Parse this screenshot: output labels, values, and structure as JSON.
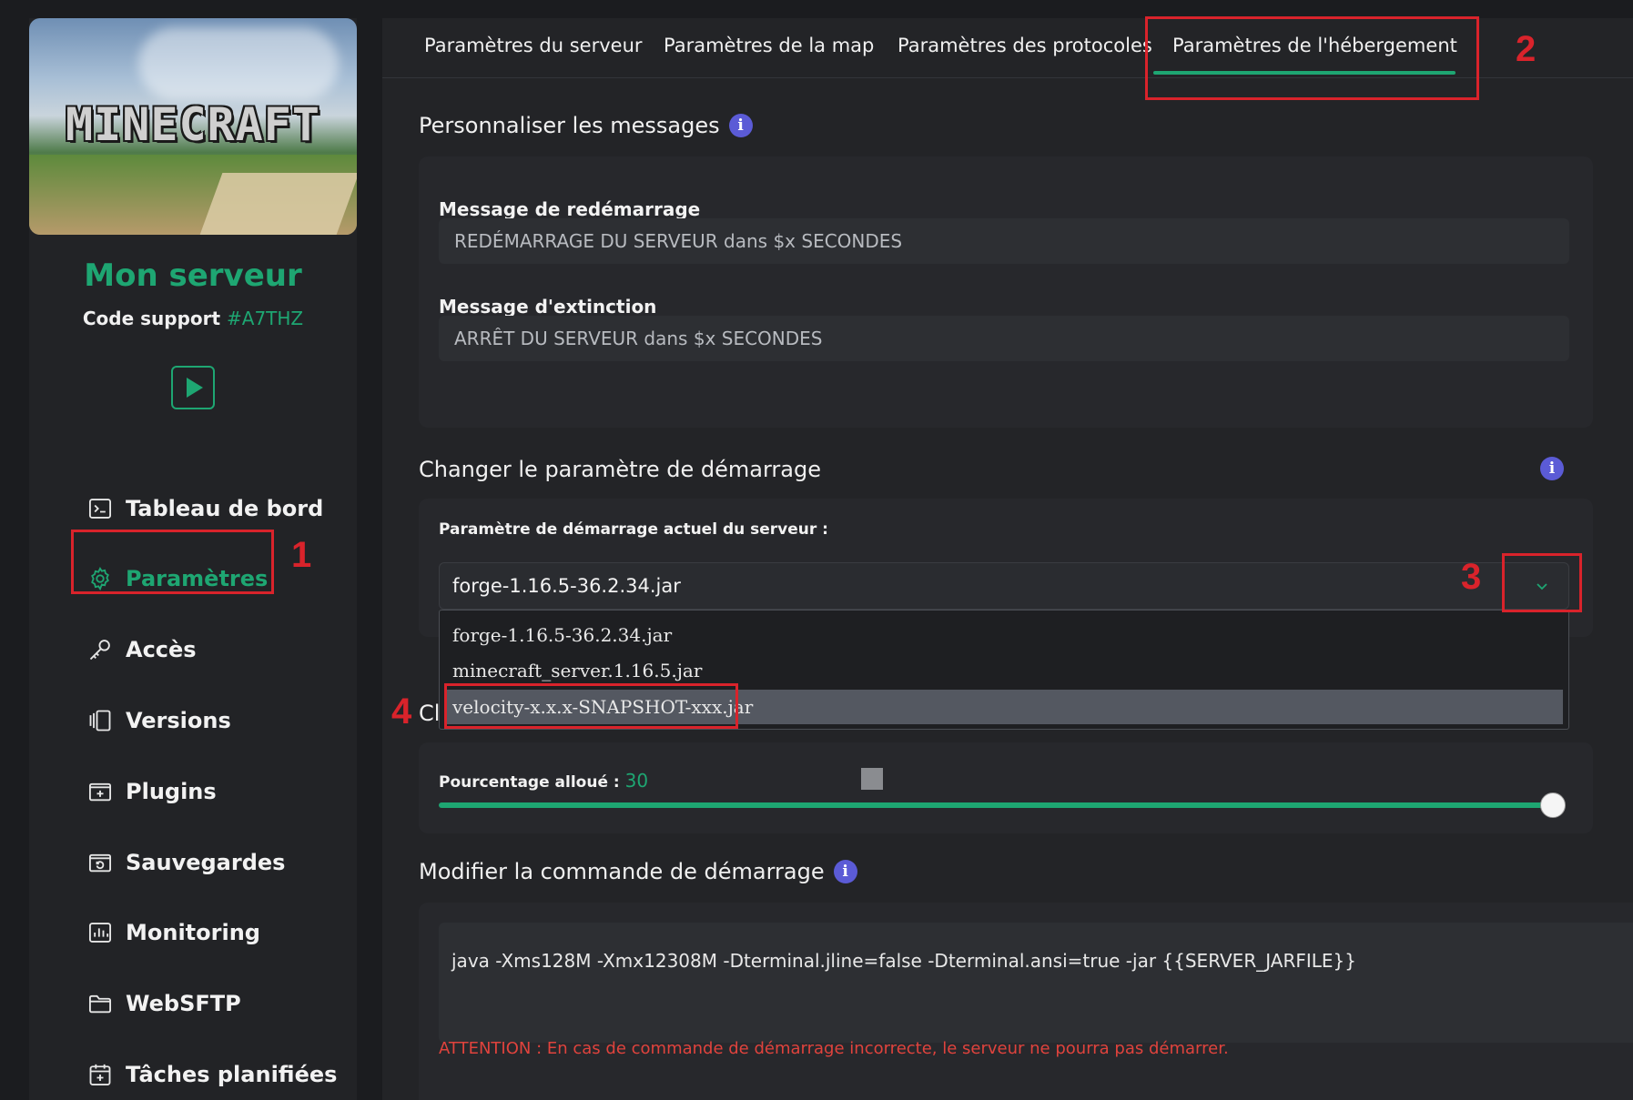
{
  "sidebar": {
    "logo_text": "MINECRAFT",
    "server_name": "Mon serveur",
    "support_label": "Code support",
    "support_code": "#A7THZ",
    "nav": [
      {
        "label": "Tableau de bord",
        "icon": "terminal-icon"
      },
      {
        "label": "Paramètres",
        "icon": "gear-icon",
        "active": true
      },
      {
        "label": "Accès",
        "icon": "key-icon"
      },
      {
        "label": "Versions",
        "icon": "versions-icon"
      },
      {
        "label": "Plugins",
        "icon": "plugin-icon"
      },
      {
        "label": "Sauvegardes",
        "icon": "backup-icon"
      },
      {
        "label": "Monitoring",
        "icon": "chart-icon"
      },
      {
        "label": "WebSFTP",
        "icon": "folder-icon"
      },
      {
        "label": "Tâches planifiées",
        "icon": "calendar-icon"
      }
    ]
  },
  "tabs": [
    {
      "label": "Paramètres du serveur"
    },
    {
      "label": "Paramètres de la map"
    },
    {
      "label": "Paramètres des protocoles"
    },
    {
      "label": "Paramètres de l'hébergement",
      "active": true
    }
  ],
  "messages": {
    "title": "Personnaliser les messages",
    "restart_label": "Message de redémarrage",
    "restart_value": "REDÉMARRAGE DU SERVEUR dans $x SECONDES",
    "shutdown_label": "Message d'extinction",
    "shutdown_value": "ARRÊT DU SERVEUR dans $x SECONDES"
  },
  "startup": {
    "title": "Changer le paramètre de démarrage",
    "current_label": "Paramètre de démarrage actuel du serveur :",
    "selected": "forge-1.16.5-36.2.34.jar",
    "options": [
      "forge-1.16.5-36.2.34.jar",
      "minecraft_server.1.16.5.jar",
      "velocity-x.x.x-SNAPSHOT-xxx.jar"
    ],
    "highlighted_option": "velocity-x.x.x-SNAPSHOT-xxx.jar"
  },
  "allocation": {
    "hidden_title_fragment": "Cl",
    "percent_label": "Pourcentage alloué :",
    "percent_value": "30"
  },
  "command": {
    "title": "Modifier la commande de démarrage",
    "value": "java -Xms128M -Xmx12308M -Dterminal.jline=false -Dterminal.ansi=true -jar {{SERVER_JARFILE}}",
    "warning": "ATTENTION : En cas de commande de démarrage incorrecte, le serveur ne pourra pas démarrer."
  },
  "annotations": [
    "1",
    "2",
    "3",
    "4"
  ],
  "colors": {
    "accent": "#1ea672",
    "annotation": "#d9232b",
    "info": "#5b5bd6",
    "warning": "#e0433d"
  }
}
